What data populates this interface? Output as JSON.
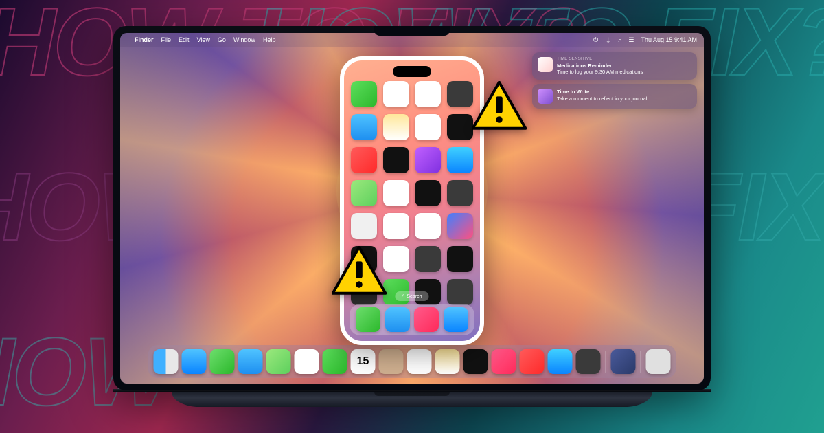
{
  "bg_text": "HOW TO FIX?",
  "menubar": {
    "app": "Finder",
    "items": [
      "File",
      "Edit",
      "View",
      "Go",
      "Window",
      "Help"
    ],
    "datetime": "Thu Aug 15  9:41 AM"
  },
  "notifications": [
    {
      "tag": "TIME SENSITIVE",
      "title": "Medications Reminder",
      "body": "Time to log your 9:30 AM medications"
    },
    {
      "tag": "",
      "title": "Time to Write",
      "body": "Take a moment to reflect in your journal."
    }
  ],
  "phone": {
    "search": "Search",
    "icons": [
      {
        "name": "facetime",
        "bg": "linear-gradient(135deg,#5dde5d,#2bb82b)"
      },
      {
        "name": "calendar",
        "bg": "#fff"
      },
      {
        "name": "photos",
        "bg": "#fff"
      },
      {
        "name": "camera",
        "bg": "#3a3a3a"
      },
      {
        "name": "mail",
        "bg": "linear-gradient(180deg,#4fc3ff,#1e8ff0)"
      },
      {
        "name": "notes",
        "bg": "linear-gradient(180deg,#ffe79a,#fff)"
      },
      {
        "name": "reminders",
        "bg": "#fff"
      },
      {
        "name": "clock",
        "bg": "#111"
      },
      {
        "name": "news",
        "bg": "linear-gradient(135deg,#ff5a5a,#ff2a2a)"
      },
      {
        "name": "tv",
        "bg": "#111"
      },
      {
        "name": "podcasts",
        "bg": "linear-gradient(135deg,#c060ff,#8030e0)"
      },
      {
        "name": "appstore",
        "bg": "linear-gradient(180deg,#3fd0ff,#0a84ff)"
      },
      {
        "name": "maps",
        "bg": "linear-gradient(135deg,#9be87d,#5dd05d)"
      },
      {
        "name": "health",
        "bg": "#fff"
      },
      {
        "name": "wallet",
        "bg": "#111"
      },
      {
        "name": "settings",
        "bg": "#3a3a3a"
      },
      {
        "name": "findmy",
        "bg": "#f0f0f0"
      },
      {
        "name": "home",
        "bg": "#fff"
      },
      {
        "name": "files",
        "bg": "#fff"
      },
      {
        "name": "shortcuts",
        "bg": "linear-gradient(135deg,#4080ff,#ff5080)"
      },
      {
        "name": "tv2",
        "bg": "#111"
      },
      {
        "name": "health2",
        "bg": "#fff"
      },
      {
        "name": "settings2",
        "bg": "#3a3a3a"
      },
      {
        "name": "stocks",
        "bg": "#111"
      },
      {
        "name": "translate",
        "bg": "#2a2a2a"
      },
      {
        "name": "facetime2",
        "bg": "linear-gradient(135deg,#5dde5d,#2bb82b)"
      },
      {
        "name": "watch",
        "bg": "#111"
      },
      {
        "name": "contacts",
        "bg": "#3a3a3a"
      }
    ],
    "dock": [
      {
        "name": "phone",
        "bg": "linear-gradient(135deg,#6dde6d,#2bb82b)"
      },
      {
        "name": "mail",
        "bg": "linear-gradient(180deg,#4fc3ff,#1e8ff0)"
      },
      {
        "name": "music",
        "bg": "linear-gradient(135deg,#ff5a8a,#ff2a5a)"
      },
      {
        "name": "safari",
        "bg": "linear-gradient(180deg,#4fc3ff,#0a84ff)"
      }
    ]
  },
  "dock": [
    {
      "name": "finder",
      "bg": "linear-gradient(90deg,#3fb0ff 50%,#e8e8e8 50%)"
    },
    {
      "name": "safari",
      "bg": "linear-gradient(180deg,#4fc3ff,#0a84ff)"
    },
    {
      "name": "messages",
      "bg": "linear-gradient(135deg,#6dde6d,#2bb82b)"
    },
    {
      "name": "mail",
      "bg": "linear-gradient(180deg,#4fc3ff,#1e8ff0)"
    },
    {
      "name": "maps",
      "bg": "linear-gradient(135deg,#9be87d,#5dd05d)"
    },
    {
      "name": "photos",
      "bg": "#fff"
    },
    {
      "name": "facetime",
      "bg": "linear-gradient(135deg,#5dde5d,#2bb82b)"
    },
    {
      "name": "calendar",
      "bg": "#fff"
    },
    {
      "name": "contacts",
      "bg": "#d0b090"
    },
    {
      "name": "reminders",
      "bg": "#fff"
    },
    {
      "name": "notes",
      "bg": "linear-gradient(180deg,#ffe79a,#fff)"
    },
    {
      "name": "tv",
      "bg": "#111"
    },
    {
      "name": "music",
      "bg": "linear-gradient(135deg,#ff5a8a,#ff2a5a)"
    },
    {
      "name": "news",
      "bg": "linear-gradient(135deg,#ff5a5a,#ff2a2a)"
    },
    {
      "name": "appstore",
      "bg": "linear-gradient(180deg,#3fd0ff,#0a84ff)"
    },
    {
      "name": "settings",
      "bg": "#3a3a3a"
    },
    {
      "name": "iphone",
      "bg": "linear-gradient(135deg,#4a5a9a,#2a3a6a)"
    },
    {
      "name": "trash",
      "bg": "#e0e0e0"
    }
  ],
  "calendar_day": "15"
}
